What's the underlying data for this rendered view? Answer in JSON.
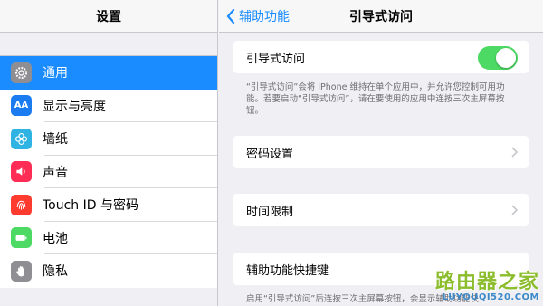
{
  "left": {
    "title": "设置",
    "items": [
      {
        "label": "通用",
        "icon": "gear-icon",
        "color": "#8e8e93",
        "selected": true
      },
      {
        "label": "显示与亮度",
        "icon": "text-size-icon",
        "color": "#1a7cf0",
        "glyph": "AA"
      },
      {
        "label": "墙纸",
        "icon": "flower-icon",
        "color": "#2eb3e3"
      },
      {
        "label": "声音",
        "icon": "speaker-icon",
        "color": "#ff2d55"
      },
      {
        "label": "Touch ID 与密码",
        "icon": "fingerprint-icon",
        "color": "#ff3b30"
      },
      {
        "label": "电池",
        "icon": "battery-icon",
        "color": "#4cd964"
      },
      {
        "label": "隐私",
        "icon": "hand-icon",
        "color": "#8e8e93"
      }
    ]
  },
  "nav": {
    "back_label": "辅助功能",
    "title": "引导式访问"
  },
  "guided_access": {
    "label": "引导式访问",
    "toggle_on": true,
    "toggle_color": "#4cd964",
    "note": "“引导式访问”会将 iPhone 维持在单个应用中，并允许您控制可用功能。若要启动“引导式访问”，请在要使用的应用中连按三次主屏幕按钮。"
  },
  "passcode": {
    "label": "密码设置"
  },
  "time_limit": {
    "label": "时间限制"
  },
  "shortcut": {
    "label": "辅助功能快捷键",
    "note": "启用“引导式访问”后连按三次主屏幕按钮，会显示辅助功能快"
  },
  "watermark": {
    "main": "路由器之家",
    "url": "LUYOUQI520.COM"
  },
  "accent": "#1a8cff"
}
